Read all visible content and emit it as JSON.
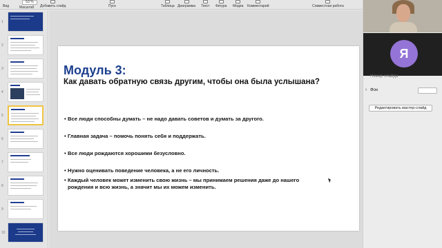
{
  "toolbar": {
    "zoom_value": "53 %",
    "items": [
      {
        "label": "Вид",
        "icon": "view-icon"
      },
      {
        "label": "Масштаб",
        "icon": "zoom-icon"
      },
      {
        "label": "Добавить слайд",
        "icon": "add-slide-icon"
      },
      {
        "label": "Пуск",
        "icon": "play-icon"
      },
      {
        "label": "Таблица",
        "icon": "table-icon"
      },
      {
        "label": "Диаграмма",
        "icon": "chart-icon"
      },
      {
        "label": "Текст",
        "icon": "text-icon"
      },
      {
        "label": "Фигура",
        "icon": "shape-icon"
      },
      {
        "label": "Медиа",
        "icon": "media-icon"
      },
      {
        "label": "Комментарий",
        "icon": "comment-icon"
      },
      {
        "label": "Совместная работа",
        "icon": "collaboration-icon"
      }
    ]
  },
  "navigator": {
    "slide_numbers": [
      "1",
      "2",
      "3",
      "4",
      "5",
      "6",
      "7",
      "8",
      "9",
      "10"
    ],
    "active_index": 4
  },
  "slide": {
    "title": "Модуль 3:",
    "subtitle": "Как давать обратную связь другим, чтобы она была услышана?",
    "bullets": [
      "Все люди способны думать – не надо давать советов и думать за другого.",
      "Главная задача – помочь понять себя и поддержать.",
      "Все люди рождаются хорошими безусловно.",
      "Нужно оценивать поведение человека, а не его личность.",
      "Каждый человек может изменить свою жизнь – мы принимаем решения даже до нашего рождения и всю жизнь, а значит мы их можем изменить."
    ]
  },
  "inspector": {
    "participant_initial": "Я",
    "slide_number_label": "Номер слайда",
    "background_label": "Фон",
    "edit_master_button": "Редактировать мастер-слайд"
  },
  "colors": {
    "title_blue": "#1c3f8e",
    "avatar_purple": "#9474d6",
    "active_thumb": "#f0c442"
  }
}
